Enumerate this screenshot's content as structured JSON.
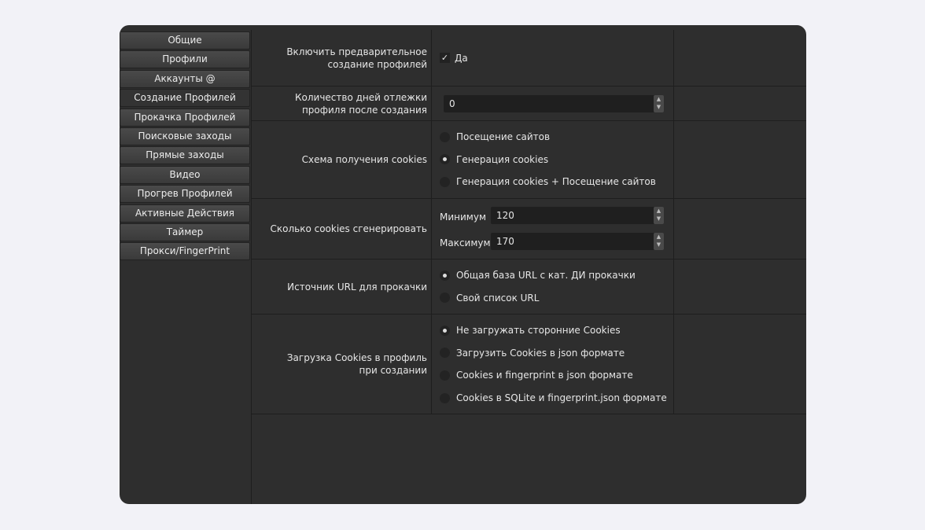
{
  "sidebar": {
    "items": [
      "Общие",
      "Профили",
      "Аккаунты @",
      "Создание Профилей",
      "Прокачка Профилей",
      "Поисковые заходы",
      "Прямые заходы",
      "Видео",
      "Прогрев Профилей",
      "Активные Действия",
      "Таймер",
      "Прокси/FingerPrint"
    ],
    "selected": "Создание Профилей"
  },
  "settings": {
    "pre_create": {
      "label": "Включить предварительное создание профилей",
      "checkbox_label": "Да",
      "checked": true
    },
    "rest_days": {
      "label": "Количество дней отлежки профиля после создания",
      "value": "0"
    },
    "cookie_scheme": {
      "label": "Схема получения cookies",
      "options": [
        "Посещение сайтов",
        "Генерация cookies",
        "Генерация cookies + Посещение сайтов"
      ],
      "selected": 1
    },
    "cookie_count": {
      "label": "Сколько cookies сгенерировать",
      "min_label": "Минимум",
      "min_value": "120",
      "max_label": "Максимум",
      "max_value": "170"
    },
    "url_source": {
      "label": "Источник URL для прокачки",
      "options": [
        "Общая база URL с кат. ДИ прокачки",
        "Свой список URL"
      ],
      "selected": 0
    },
    "cookie_load": {
      "label": "Загрузка Cookies в профиль при создании",
      "options": [
        "Не загружать сторонние Cookies",
        "Загрузить Cookies в json формате",
        "Cookies и fingerprint в json формате",
        "Cookies в SQLite и fingerprint.json формате"
      ],
      "selected": 0
    }
  }
}
